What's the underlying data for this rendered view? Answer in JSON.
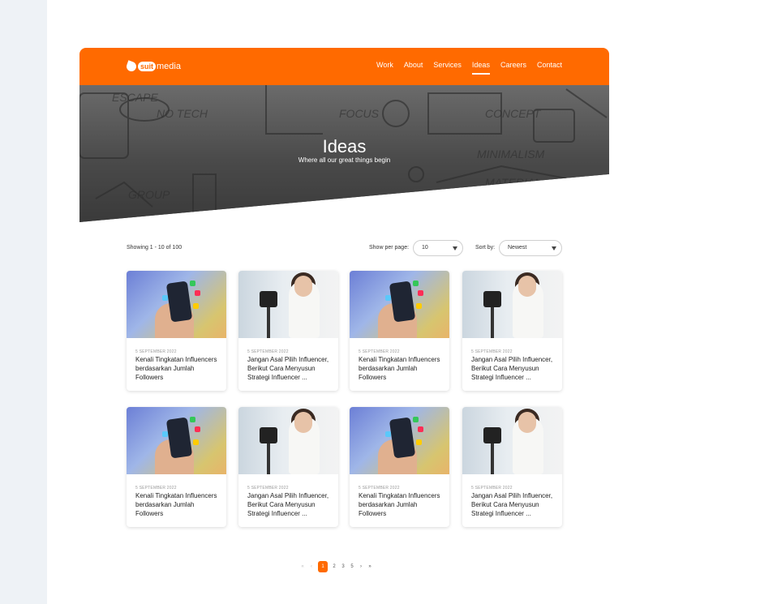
{
  "nav": {
    "logo_strong": "suit",
    "logo_text": "media",
    "links": [
      "Work",
      "About",
      "Services",
      "Ideas",
      "Careers",
      "Contact"
    ],
    "active_index": 3
  },
  "hero": {
    "title": "Ideas",
    "subtitle": "Where all our great things begin"
  },
  "listing": {
    "showing": "Showing 1 - 10 of 100",
    "per_page_label": "Show per page:",
    "per_page_value": "10",
    "sort_label": "Sort by:",
    "sort_value": "Newest"
  },
  "cards": [
    {
      "date": "5 SEPTEMBER 2022",
      "title": "Kenali Tingkatan Influencers berdasarkan Jumlah Followers",
      "thumb": "social-media-phone"
    },
    {
      "date": "5 SEPTEMBER 2022",
      "title": "Jangan Asal Pilih Influencer, Berikut Cara Menyusun Strategi Influencer ...",
      "thumb": "vlogger-camera"
    },
    {
      "date": "5 SEPTEMBER 2022",
      "title": "Kenali Tingkatan Influencers berdasarkan Jumlah Followers",
      "thumb": "social-media-phone"
    },
    {
      "date": "5 SEPTEMBER 2022",
      "title": "Jangan Asal Pilih Influencer, Berikut Cara Menyusun Strategi Influencer ...",
      "thumb": "vlogger-camera"
    },
    {
      "date": "5 SEPTEMBER 2022",
      "title": "Kenali Tingkatan Influencers berdasarkan Jumlah Followers",
      "thumb": "social-media-phone"
    },
    {
      "date": "5 SEPTEMBER 2022",
      "title": "Jangan Asal Pilih Influencer, Berikut Cara Menyusun Strategi Influencer ...",
      "thumb": "vlogger-camera"
    },
    {
      "date": "5 SEPTEMBER 2022",
      "title": "Kenali Tingkatan Influencers berdasarkan Jumlah Followers",
      "thumb": "social-media-phone"
    },
    {
      "date": "5 SEPTEMBER 2022",
      "title": "Jangan Asal Pilih Influencer, Berikut Cara Menyusun Strategi Influencer ...",
      "thumb": "vlogger-camera"
    }
  ],
  "pagination": {
    "first": "«",
    "prev": "‹",
    "pages": [
      "1",
      "2",
      "3",
      "5"
    ],
    "current": "1",
    "next": "›",
    "last": "»"
  },
  "colors": {
    "brand": "#ff6a00",
    "rail": "#eef2f6"
  }
}
